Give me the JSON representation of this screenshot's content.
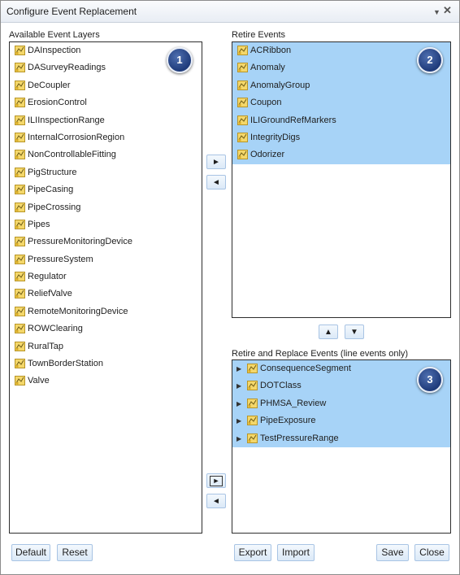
{
  "window": {
    "title": "Configure Event Replacement"
  },
  "available": {
    "label": "Available Event Layers",
    "badge": "1",
    "items": [
      "DAInspection",
      "DASurveyReadings",
      "DeCoupler",
      "ErosionControl",
      "ILIInspectionRange",
      "InternalCorrosionRegion",
      "NonControllableFitting",
      "PigStructure",
      "PipeCasing",
      "PipeCrossing",
      "Pipes",
      "PressureMonitoringDevice",
      "PressureSystem",
      "Regulator",
      "ReliefValve",
      "RemoteMonitoringDevice",
      "ROWClearing",
      "RuralTap",
      "TownBorderStation",
      "Valve"
    ]
  },
  "retire": {
    "label": "Retire Events",
    "badge": "2",
    "items": [
      "ACRibbon",
      "Anomaly",
      "AnomalyGroup",
      "Coupon",
      "ILIGroundRefMarkers",
      "IntegrityDigs",
      "Odorizer"
    ]
  },
  "replace": {
    "label": "Retire and Replace Events (line events only)",
    "badge": "3",
    "items": [
      "ConsequenceSegment",
      "DOTClass",
      "PHMSA_Review",
      "PipeExposure",
      "TestPressureRange"
    ]
  },
  "arrows": {
    "right": "►",
    "left": "◄",
    "up": "▲",
    "down": "▼"
  },
  "buttons": {
    "default": "Default",
    "reset": "Reset",
    "export": "Export",
    "import": "Import",
    "save": "Save",
    "close": "Close"
  },
  "colors": {
    "selection": "#a7d3f7",
    "button_bg": "#dbe9f7",
    "badge": "#2b4a8a"
  },
  "icons": {
    "layer": "layer-icon",
    "expand": "expand-arrow-icon"
  }
}
